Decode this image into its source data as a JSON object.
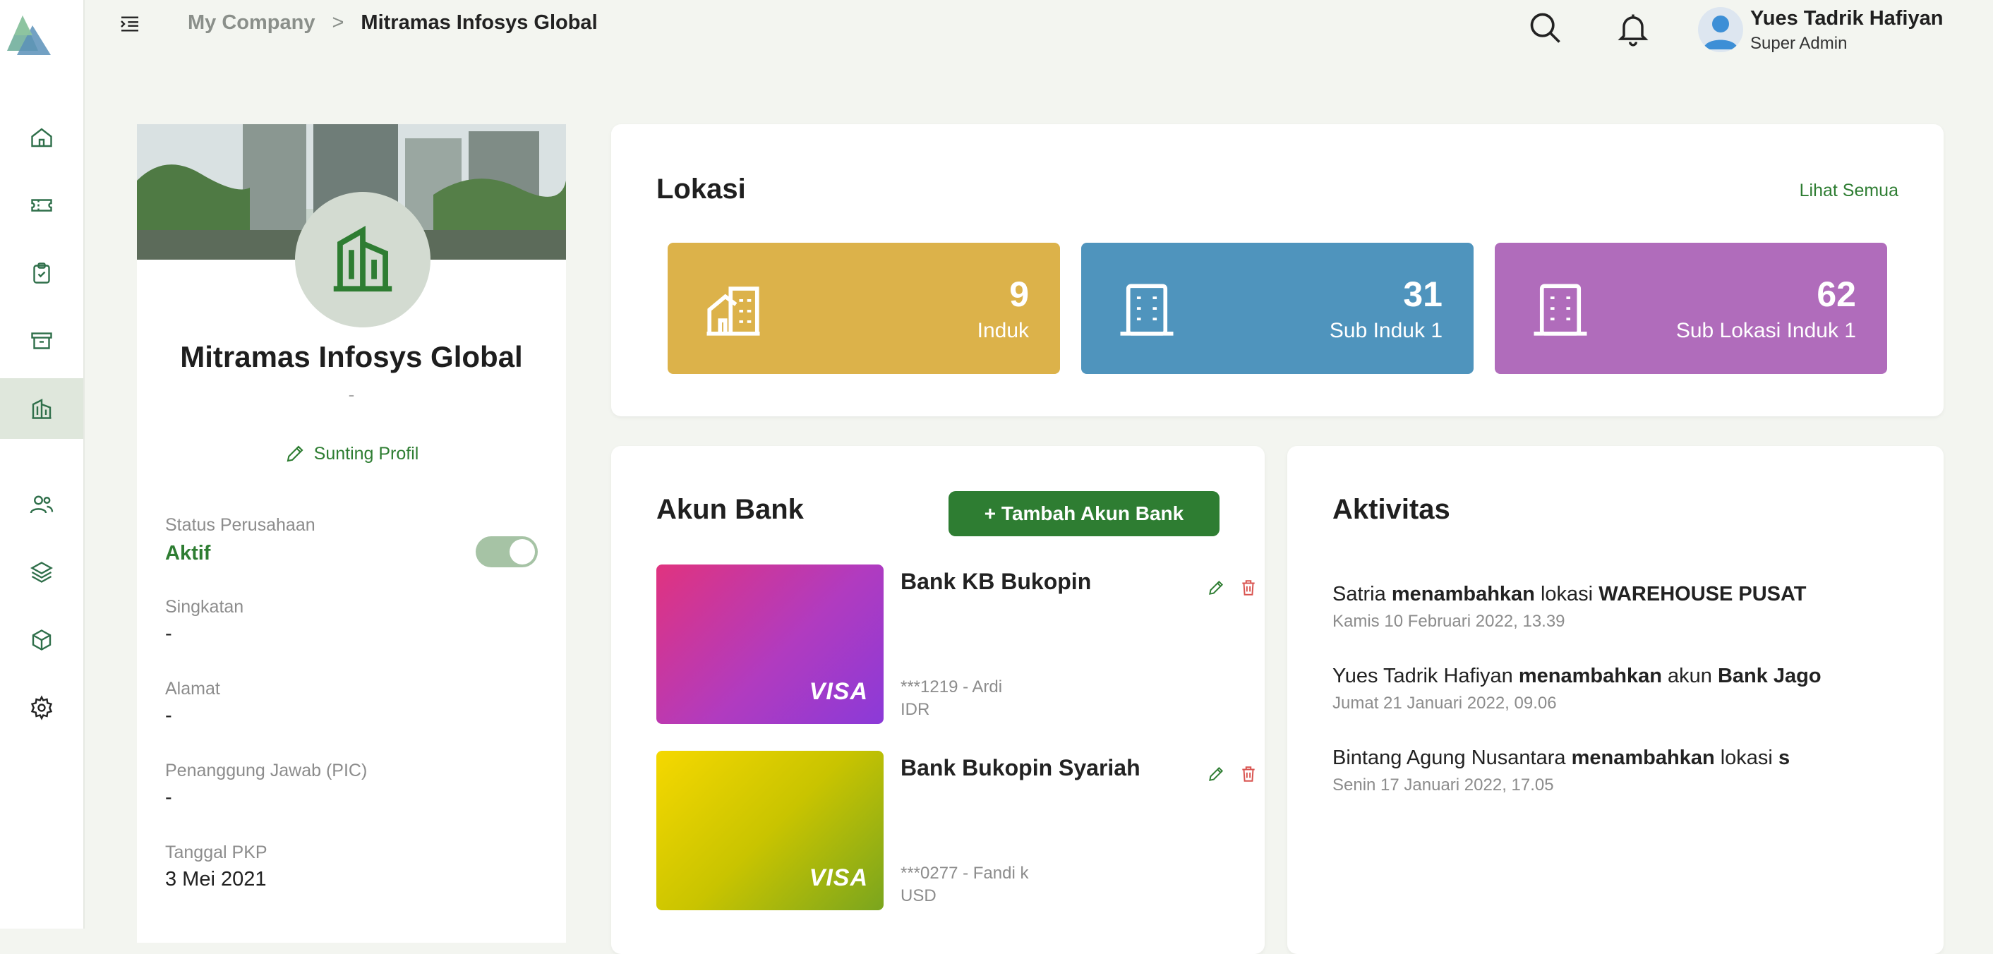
{
  "header": {
    "breadcrumb_parent": "My Company",
    "breadcrumb_separator": ">",
    "breadcrumb_current": "Mitramas Infosys Global",
    "user_name": "Yues Tadrik Hafiyan",
    "user_role": "Super Admin"
  },
  "sidebar": {
    "items": [
      {
        "icon": "home-icon"
      },
      {
        "icon": "ticket-icon"
      },
      {
        "icon": "clipboard-check-icon"
      },
      {
        "icon": "archive-icon"
      },
      {
        "icon": "building-icon",
        "active": true
      },
      {
        "icon": "users-icon"
      },
      {
        "icon": "layers-icon"
      },
      {
        "icon": "cube-icon"
      },
      {
        "icon": "gear-icon"
      }
    ]
  },
  "profile": {
    "company_name": "Mitramas Infosys Global",
    "subtitle": "-",
    "edit_label": "Sunting Profil",
    "status_label": "Status Perusahaan",
    "status_value": "Aktif",
    "status_on": true,
    "abbr_label": "Singkatan",
    "abbr_value": "-",
    "address_label": "Alamat",
    "address_value": "-",
    "pic_label": "Penanggung Jawab (PIC)",
    "pic_value": "-",
    "pkp_label": "Tanggal PKP",
    "pkp_value": "3 Mei 2021"
  },
  "lokasi": {
    "title": "Lokasi",
    "see_all": "Lihat Semua",
    "stats": [
      {
        "value": "9",
        "label": "Induk",
        "color": "#dcb24a"
      },
      {
        "value": "31",
        "label": "Sub Induk 1",
        "color": "#4f94bd"
      },
      {
        "value": "62",
        "label": "Sub Lokasi Induk 1",
        "color": "#b06cbb"
      }
    ]
  },
  "bank": {
    "title": "Akun Bank",
    "add_label": "+ Tambah Akun Bank",
    "accounts": [
      {
        "name": "Bank KB Bukopin",
        "account": "***1219 - Ardi",
        "currency": "IDR",
        "brand": "VISA"
      },
      {
        "name": "Bank Bukopin Syariah",
        "account": "***0277 - Fandi k",
        "currency": "USD",
        "brand": "VISA"
      }
    ]
  },
  "activity": {
    "title": "Aktivitas",
    "items": [
      {
        "actor": "Satria",
        "verb": "menambahkan",
        "mid": "lokasi",
        "target": "WAREHOUSE PUSAT",
        "time": "Kamis 10 Februari 2022, 13.39"
      },
      {
        "actor": "Yues Tadrik Hafiyan",
        "verb": "menambahkan",
        "mid": "akun",
        "target": "Bank Jago",
        "time": "Jumat 21 Januari 2022, 09.06"
      },
      {
        "actor": "Bintang Agung Nusantara",
        "verb": "menambahkan",
        "mid": "lokasi",
        "target": "s",
        "time": "Senin 17 Januari 2022, 17.05"
      }
    ]
  },
  "colors": {
    "accent": "#2e7d32",
    "danger": "#d9534f"
  }
}
